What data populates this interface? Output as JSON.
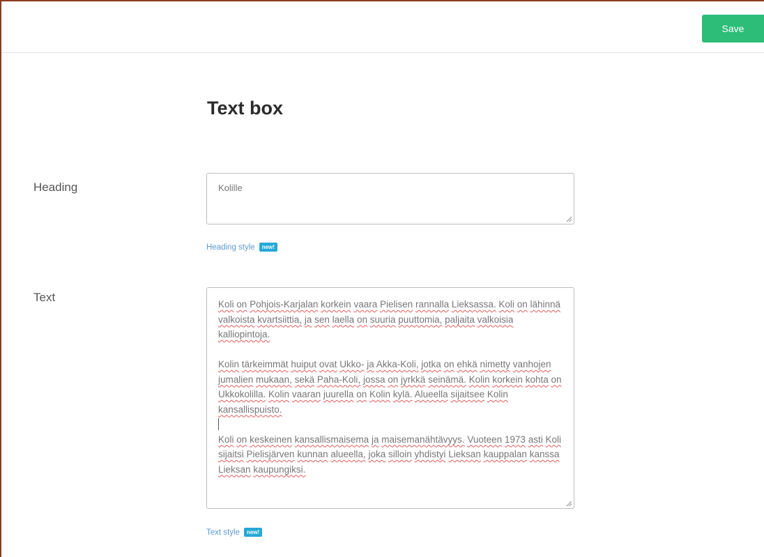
{
  "toolbar": {
    "save_label": "Save"
  },
  "page": {
    "title": "Text box"
  },
  "heading_field": {
    "label": "Heading",
    "value": "Kolille",
    "style_link": "Heading style",
    "badge": "new!"
  },
  "text_field": {
    "label": "Text",
    "paragraphs": [
      "Koli on Pohjois-Karjalan korkein vaara Pielisen rannalla Lieksassa. Koli on lähinnä valkoista kvartsiittia, ja sen laella on suuria puuttomia, paljaita valkoisia kalliopintoja.",
      " Kolin tärkeimmät huiput ovat Ukko- ja Akka-Koli, jotka on ehkä nimetty vanhojen jumalien mukaan, sekä Paha-Koli, jossa on jyrkkä seinämä. Kolin korkein kohta on Ukkokolilla. Kolin vaaran juurella on Kolin kylä. Alueella sijaitsee Kolin kansallispuisto.",
      "Koli on keskeinen kansallismaisema ja maisemanähtävyys. Vuoteen 1973 asti Koli sijaitsi Pielisjärven kunnan alueella, joka silloin yhdistyi Lieksan kauppalan kanssa Lieksan kaupungiksi."
    ],
    "style_link": "Text style",
    "badge": "new!"
  },
  "colors": {
    "save_button": "#2dbd79",
    "badge": "#27a8d6",
    "link": "#5d9ad0",
    "spellcheck": "#e05a5a"
  }
}
